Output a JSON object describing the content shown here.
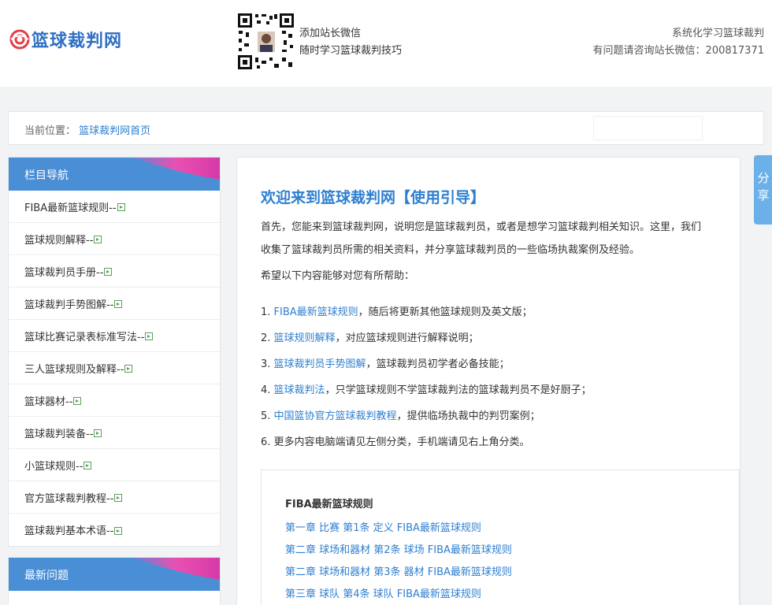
{
  "header": {
    "logo_text": "篮球裁判网",
    "qr_lines": [
      "添加站长微信",
      "随时学习篮球裁判技巧"
    ],
    "right_lines": [
      "系统化学习篮球裁判",
      "有问题请咨询站长微信：200817371"
    ]
  },
  "breadcrumb": {
    "prefix": "当前位置：",
    "home_link": "篮球裁判网首页"
  },
  "sidebar": {
    "nav_title": "栏目导航",
    "items": [
      {
        "label": "FIBA最新篮球规则--"
      },
      {
        "label": "篮球规则解释--"
      },
      {
        "label": "篮球裁判员手册--"
      },
      {
        "label": "篮球裁判手势图解--"
      },
      {
        "label": "篮球比赛记录表标准写法--"
      },
      {
        "label": "三人篮球规则及解释--"
      },
      {
        "label": "篮球器材--"
      },
      {
        "label": "篮球裁判装备--"
      },
      {
        "label": "小篮球规则--"
      },
      {
        "label": "官方篮球裁判教程--"
      },
      {
        "label": "篮球裁判基本术语--"
      }
    ],
    "latest_title": "最新问题"
  },
  "main": {
    "title": "欢迎来到篮球裁判网【使用引导】",
    "intro_line1": "首先，您能来到篮球裁判网，说明您是篮球裁判员，或者是想学习篮球裁判相关知识。这里，我们",
    "intro_line2": "收集了篮球裁判员所需的相关资料，并分享篮球裁判员的一些临场执裁案例及经验。",
    "hope": "希望以下内容能够对您有所帮助：",
    "list": [
      {
        "num": "1. ",
        "link": "FIBA最新篮球规则",
        "rest": "，随后将更新其他篮球规则及英文版；"
      },
      {
        "num": "2. ",
        "link": "篮球规则解释",
        "rest": "，对应篮球规则进行解释说明；"
      },
      {
        "num": "3. ",
        "link": "篮球裁判员手势图解",
        "rest": "，篮球裁判员初学者必备技能；"
      },
      {
        "num": "4. ",
        "link": "篮球裁判法",
        "rest": "，只学篮球规则不学篮球裁判法的篮球裁判员不是好厨子；"
      },
      {
        "num": "5. ",
        "link": "中国篮协官方篮球裁判教程",
        "rest": "，提供临场执裁中的判罚案例；"
      },
      {
        "num": "6. ",
        "link": "",
        "rest": "更多内容电脑端请见左侧分类，手机端请见右上角分类。"
      }
    ],
    "box_title": "FIBA最新篮球规则",
    "box_links": [
      "第一章 比赛 第1条 定义 FIBA最新篮球规则",
      "第二章 球场和器材 第2条 球场 FIBA最新篮球规则",
      "第二章 球场和器材 第3条 器材 FIBA最新篮球规则",
      "第三章 球队 第4条 球队 FIBA最新篮球规则"
    ]
  },
  "share": {
    "label": "分享"
  },
  "colors": {
    "accent": "#2f7fd0",
    "nav_head": "#4a8fd6",
    "deco": "#e94fb3"
  }
}
